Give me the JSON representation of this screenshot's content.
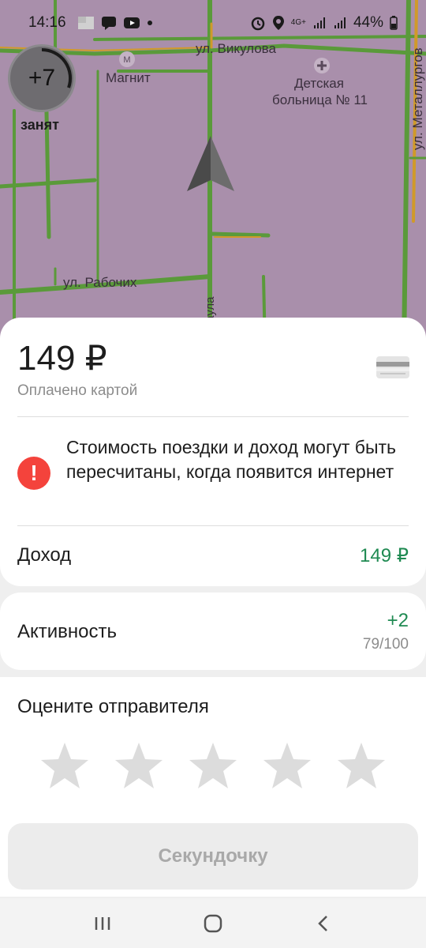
{
  "status_bar": {
    "time": "14:16",
    "network": "4G+",
    "battery": "44%"
  },
  "map": {
    "labels": {
      "street_vikulova": "ул. Викулова",
      "store_magnit": "Магнит",
      "hospital_line1": "Детская",
      "hospital_line2": "больница № 11",
      "street_rabochikh": "ул. Рабочих",
      "street_metallurgov": "ул. Металлургов",
      "street_kraula": "Краула"
    },
    "priority_value": "+7",
    "priority_status": "занят"
  },
  "order": {
    "price": "149 ₽",
    "payment_method": "Оплачено картой",
    "warning_text": "Стоимость поездки и доход могут быть пересчитаны, когда появится интернет",
    "income_label": "Доход",
    "income_value": "149 ₽"
  },
  "activity": {
    "label": "Активность",
    "delta": "+2",
    "total": "79/100"
  },
  "rating": {
    "title": "Оцените отправителя",
    "stars_count": 5,
    "selected": 0
  },
  "submit_button": {
    "label": "Секундочку"
  },
  "colors": {
    "map_background": "#a98fab",
    "road_green": "#5a9a3a",
    "road_orange": "#d09a2a",
    "income_green": "#1f8a52",
    "warning_red": "#f4433c"
  }
}
